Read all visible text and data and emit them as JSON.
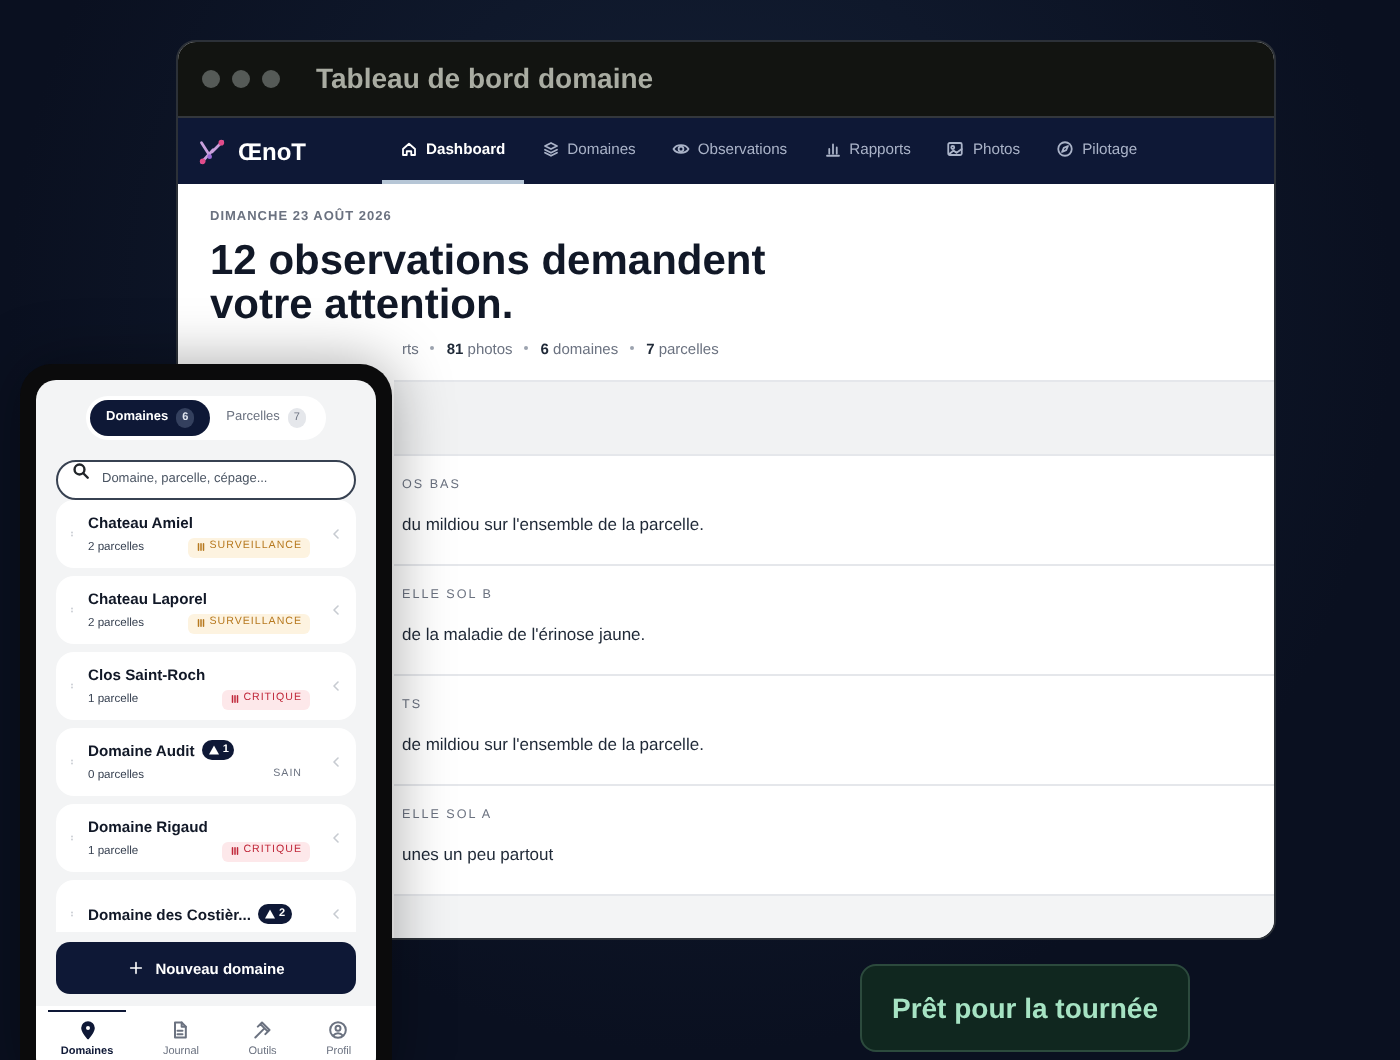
{
  "window": {
    "title": "Tableau de bord domaine"
  },
  "navbar": {
    "brand": "ŒnoT",
    "items": [
      {
        "label": "Dashboard",
        "selected": true
      },
      {
        "label": "Domaines",
        "selected": false
      },
      {
        "label": "Observations",
        "selected": false
      },
      {
        "label": "Rapports",
        "selected": false
      },
      {
        "label": "Photos",
        "selected": false
      },
      {
        "label": "Pilotage",
        "selected": false
      }
    ]
  },
  "dashboard": {
    "date": "DIMANCHE 23 AOÛT 2026",
    "headline": "12 observations demandent votre attention.",
    "stats": [
      "rts",
      "**81** photos",
      "**6** domaines",
      "**7** parcelles"
    ],
    "observations": [
      {
        "label": "OS BAS",
        "text": "du mildiou sur l'ensemble de la parcelle."
      },
      {
        "label": "ELLE SOL B",
        "text": "de la maladie de l'érinose jaune."
      },
      {
        "label": "TS",
        "text": "de mildiou sur l'ensemble de la parcelle."
      },
      {
        "label": "ELLE SOL A",
        "text": "unes un peu partout"
      }
    ]
  },
  "phone": {
    "segments": [
      {
        "label": "Domaines",
        "count": "6",
        "selected": true
      },
      {
        "label": "Parcelles",
        "count": "7",
        "selected": false
      }
    ],
    "search": {
      "placeholder": "Domaine, parcelle, cépage..."
    },
    "domains": [
      {
        "name": "Chateau Amiel",
        "parcels": "2 parcelles",
        "status": "SURVEILLANCE",
        "kind": "watch"
      },
      {
        "name": "Chateau Laporel",
        "parcels": "2 parcelles",
        "status": "SURVEILLANCE",
        "kind": "watch"
      },
      {
        "name": "Clos Saint-Roch",
        "parcels": "1 parcelle",
        "status": "CRITIQUE",
        "kind": "critical"
      },
      {
        "name": "Domaine Audit",
        "alerts": "1",
        "parcels": "0 parcelles",
        "status": "SAIN",
        "kind": "healthy"
      },
      {
        "name": "Domaine Rigaud",
        "parcels": "1 parcelle",
        "status": "CRITIQUE",
        "kind": "critical"
      },
      {
        "name": "Domaine des Costièr...",
        "alerts": "2"
      }
    ],
    "add_button": "Nouveau domaine",
    "tabs": [
      {
        "label": "Domaines",
        "selected": true
      },
      {
        "label": "Journal",
        "selected": false
      },
      {
        "label": "Outils",
        "selected": false
      },
      {
        "label": "Profil",
        "selected": false
      }
    ]
  },
  "toast": "Prêt pour la tournée"
}
